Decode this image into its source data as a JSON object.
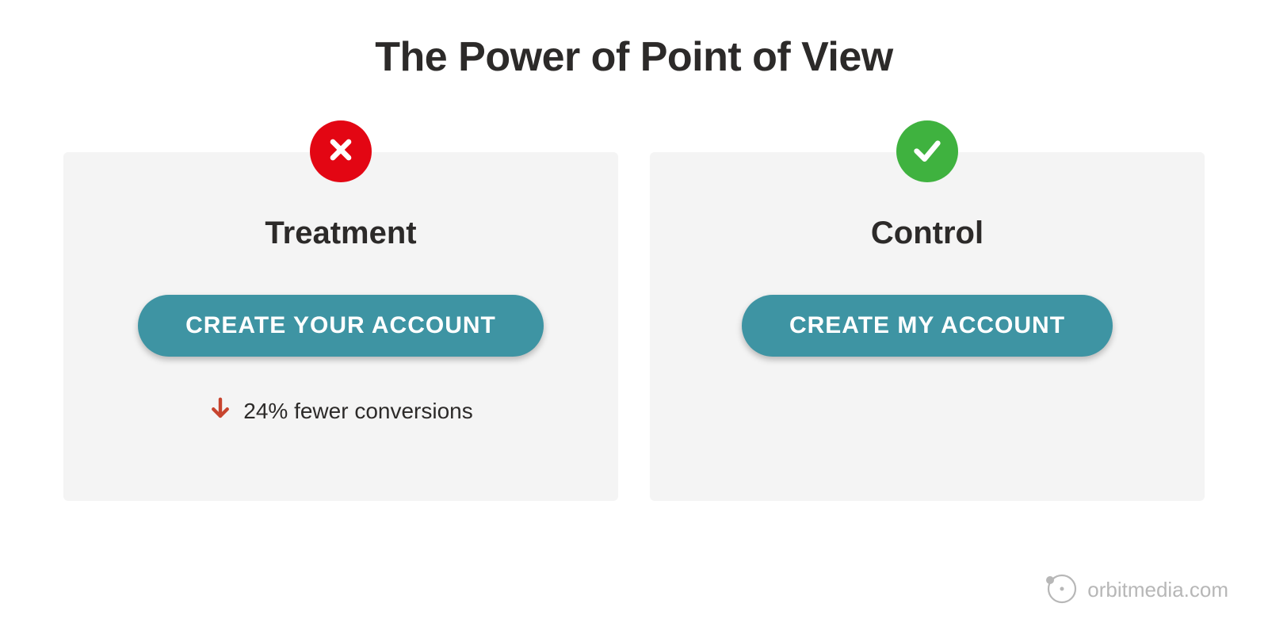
{
  "title": "The Power of Point of View",
  "cards": {
    "treatment": {
      "label": "Treatment",
      "cta": "CREATE YOUR ACCOUNT",
      "result": "24% fewer conversions"
    },
    "control": {
      "label": "Control",
      "cta": "CREATE MY ACCOUNT"
    }
  },
  "footer": "orbitmedia.com",
  "colors": {
    "bad_badge": "#e30613",
    "good_badge": "#3fb23f",
    "cta_bg": "#3e94a3",
    "down_arrow": "#c7442e",
    "text": "#2c2a29"
  }
}
